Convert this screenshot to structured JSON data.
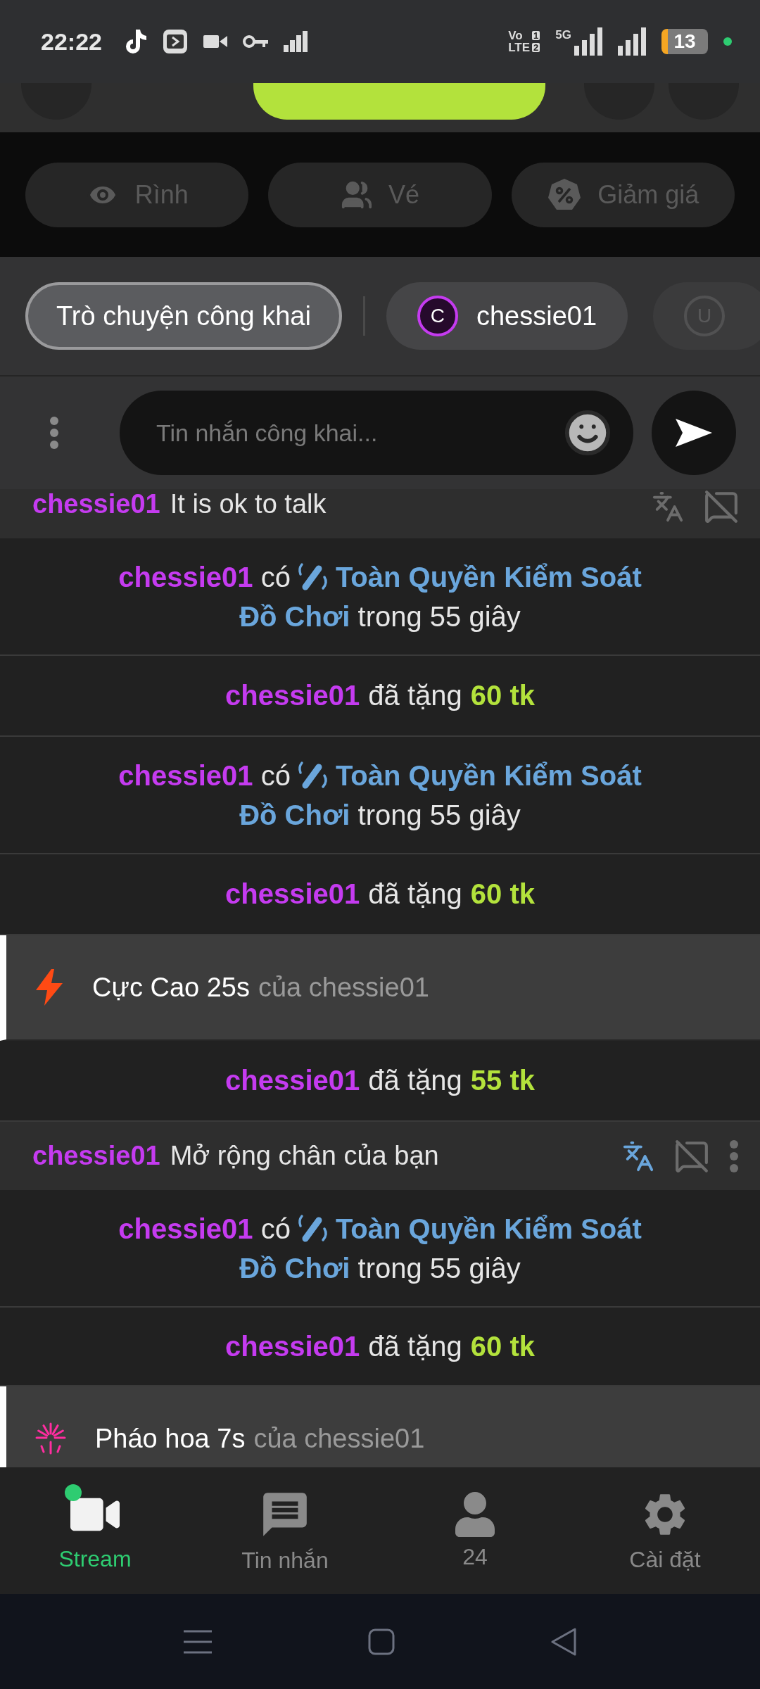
{
  "status_bar": {
    "time": "22:22",
    "volte": {
      "line1": "Vo",
      "sim1": "1",
      "line2": "LTE",
      "sim2": "2"
    },
    "network": "5G",
    "battery": "13"
  },
  "actions": [
    {
      "label": "Rình"
    },
    {
      "label": "Vé"
    },
    {
      "label": "Giảm giá"
    }
  ],
  "tabs": [
    {
      "kind": "public",
      "label": "Trò chuyện công khai",
      "selected": true
    },
    {
      "kind": "user",
      "avatar": "C",
      "label": "chessie01",
      "selected": false
    },
    {
      "kind": "user",
      "avatar": "U",
      "selected": false
    }
  ],
  "composer": {
    "placeholder": "Tin nhắn công khai..."
  },
  "messages": [
    {
      "kind": "chat",
      "user": "chessie01",
      "text": "It is ok to talk",
      "selected": false
    },
    {
      "kind": "toy",
      "user": "chessie01",
      "verb": "có",
      "feature": "Toàn Quyền Kiểm Soát Đồ Chơi",
      "suffix": "trong 55 giây"
    },
    {
      "kind": "gift",
      "user": "chessie01",
      "verb": "đã tặng",
      "amount": "60 tk"
    },
    {
      "kind": "toy",
      "user": "chessie01",
      "verb": "có",
      "feature": "Toàn Quyền Kiểm Soát Đồ Chơi",
      "suffix": "trong 55 giây"
    },
    {
      "kind": "gift",
      "user": "chessie01",
      "verb": "đã tặng",
      "amount": "60 tk"
    },
    {
      "kind": "boost",
      "title": "Cực Cao 25s",
      "by": "của chessie01"
    },
    {
      "kind": "gift",
      "user": "chessie01",
      "verb": "đã tặng",
      "amount": "55 tk"
    },
    {
      "kind": "chat",
      "user": "chessie01",
      "text": "Mở rộng chân của bạn",
      "selected": true
    },
    {
      "kind": "toy",
      "user": "chessie01",
      "verb": "có",
      "feature": "Toàn Quyền Kiểm Soát Đồ Chơi",
      "suffix": "trong 55 giây"
    },
    {
      "kind": "gift",
      "user": "chessie01",
      "verb": "đã tặng",
      "amount": "60 tk"
    },
    {
      "kind": "fireworks",
      "title": "Pháo hoa 7s",
      "by": "của chessie01"
    }
  ],
  "nav": {
    "items": [
      {
        "label": "Stream",
        "selected": true,
        "live": true
      },
      {
        "label": "Tin nhắn",
        "selected": false,
        "live": false
      },
      {
        "label": "24",
        "selected": false,
        "live": false
      },
      {
        "label": "Cài đặt",
        "selected": false,
        "live": false
      }
    ]
  }
}
